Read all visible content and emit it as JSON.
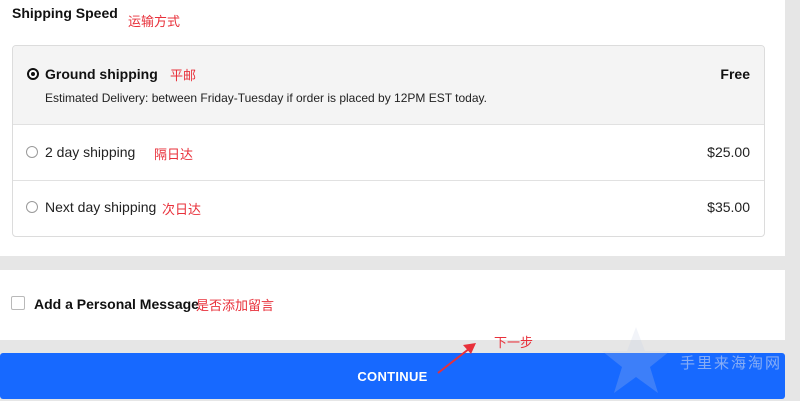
{
  "shipping": {
    "title": "Shipping Speed",
    "title_note": "运输方式",
    "options": [
      {
        "label": "Ground shipping",
        "note": "平邮",
        "price": "Free",
        "description": "Estimated Delivery: between Friday-Tuesday if order is placed by 12PM EST today.",
        "selected": true
      },
      {
        "label": "2 day shipping",
        "note": "隔日达",
        "price": "$25.00",
        "selected": false
      },
      {
        "label": "Next day shipping",
        "note": "次日达",
        "price": "$35.00",
        "selected": false
      }
    ]
  },
  "personal_message": {
    "label": "Add a Personal Message",
    "note": "是否添加留言",
    "checked": false
  },
  "continue_button": {
    "label": "CONTINUE",
    "note": "下一步"
  },
  "watermark": {
    "text": "手里来海淘网"
  },
  "colors": {
    "accent": "#1769ff",
    "annotation": "#e8303a",
    "background": "#e6e6e6"
  }
}
